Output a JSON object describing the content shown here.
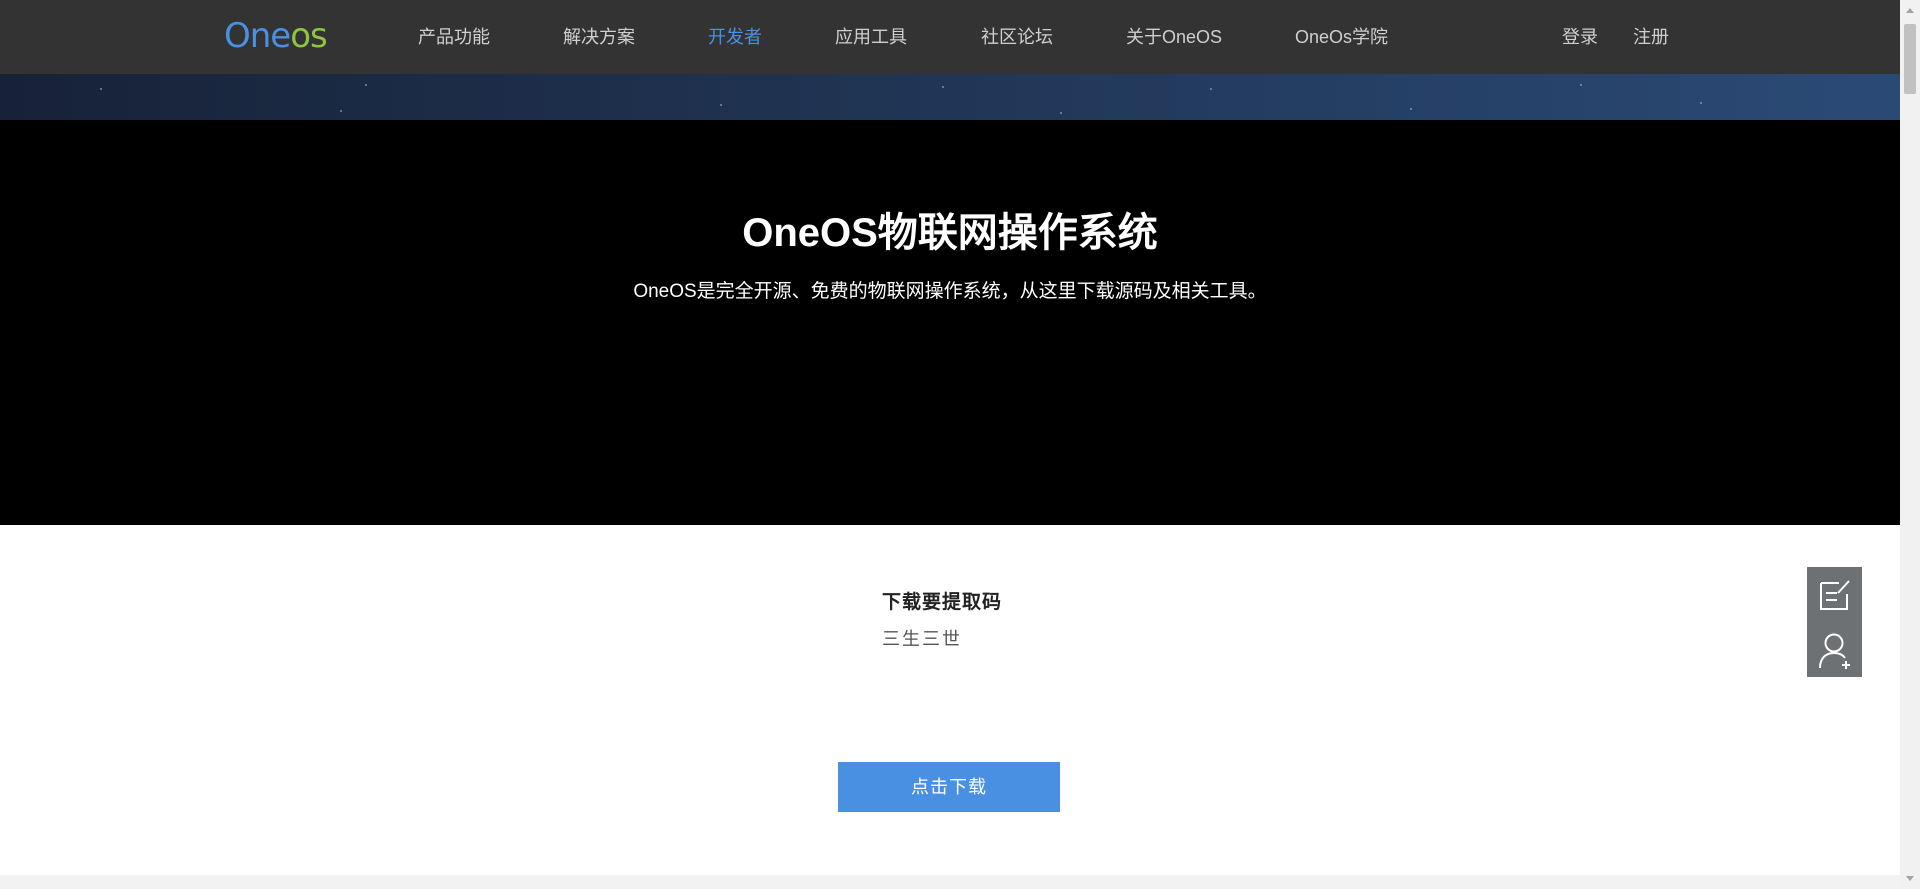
{
  "header": {
    "logo_text_blue": "One",
    "logo_text_green": "os",
    "nav": [
      {
        "label": "产品功能"
      },
      {
        "label": "解决方案"
      },
      {
        "label": "开发者"
      },
      {
        "label": "应用工具"
      },
      {
        "label": "社区论坛"
      },
      {
        "label": "关于OneOS"
      },
      {
        "label": "OneOs学院"
      }
    ],
    "active_nav": "开发者",
    "login_label": "登录",
    "register_label": "注册"
  },
  "hero": {
    "title": "OneOS物联网操作系统",
    "subtitle": "OneOS是完全开源、免费的物联网操作系统，从这里下载源码及相关工具。"
  },
  "download": {
    "code_label": "下载要提取码",
    "code_value": "三生三世",
    "button_label": "点击下载"
  },
  "side_tools": [
    {
      "icon": "edit-note-icon"
    },
    {
      "icon": "add-user-icon"
    }
  ],
  "colors": {
    "header_bg": "#333333",
    "accent": "#4a90e2",
    "logo_green": "#8cc63f",
    "hero_bg": "#000000",
    "side_tools_bg": "#6d7174"
  }
}
